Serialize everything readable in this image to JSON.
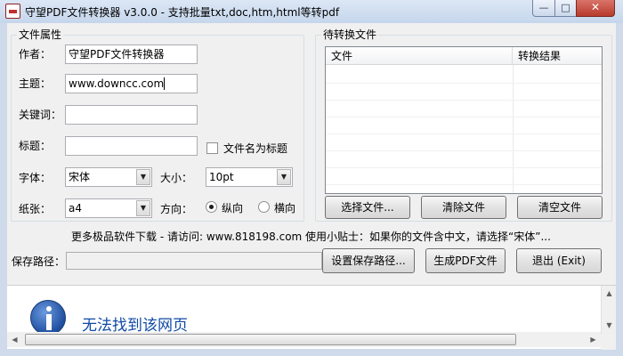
{
  "window": {
    "title": "守望PDF文件转换器 v3.0.0 - 支持批量txt,doc,htm,html等转pdf",
    "minimize": "—",
    "maximize": "□",
    "close": "✕"
  },
  "file_props": {
    "group_title": "文件属性",
    "author_label": "作者：",
    "author_value": "守望PDF文件转换器",
    "subject_label": "主题：",
    "subject_value": "www.downcc.com",
    "keywords_label": "关键词：",
    "keywords_value": "",
    "title_label": "标题：",
    "title_value": "",
    "filename_as_title_label": "文件名为标题",
    "font_label": "字体：",
    "font_value": "宋体",
    "size_label": "大小：",
    "size_value": "10pt",
    "paper_label": "纸张：",
    "paper_value": "a4",
    "orientation_label": "方向：",
    "portrait_label": "纵向",
    "landscape_label": "横向"
  },
  "pending": {
    "group_title": "待转换文件",
    "columns": [
      "文件",
      "转换结果"
    ],
    "select_button": "选择文件...",
    "clear_button": "清除文件",
    "empty_button": "清空文件"
  },
  "tip": "更多极品软件下载 - 请访问: www.818198.com  使用小贴士：如果你的文件含中文，请选择“宋体”...",
  "save": {
    "label": "保存路径：",
    "value": "",
    "set_button": "设置保存路径...",
    "generate_button": "生成PDF文件",
    "exit_button": "退出 (Exit)"
  },
  "browser": {
    "message": "无法找到该网页"
  }
}
